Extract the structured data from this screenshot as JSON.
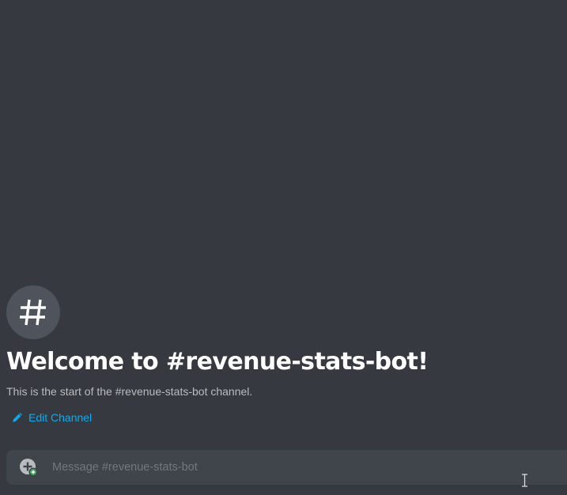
{
  "welcome": {
    "title": "Welcome to #revenue-stats-bot!",
    "subtitle": "This is the start of the #revenue-stats-bot channel.",
    "avatar_icon": "hashtag-icon",
    "edit_channel_label": "Edit Channel",
    "edit_icon": "pencil-icon"
  },
  "composer": {
    "placeholder": "Message #revenue-stats-bot",
    "attach_icon": "add-circle-icon"
  },
  "colors": {
    "background": "#36393f",
    "composer_bg": "#40444b",
    "avatar_bg": "#4f545c",
    "link": "#00aff4",
    "title": "#ffffff",
    "subtitle": "#b9bbbe",
    "placeholder": "#72767d",
    "attach_badge": "#3ba55c"
  }
}
